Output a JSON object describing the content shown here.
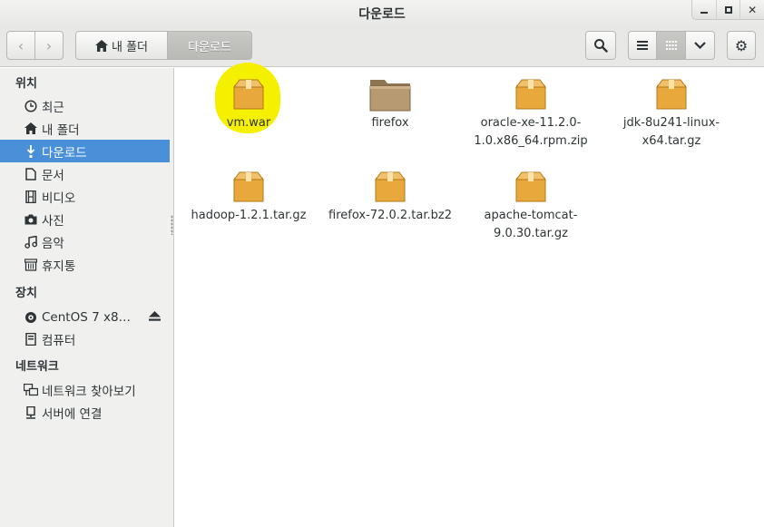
{
  "window": {
    "title": "다운로드",
    "controls": [
      "minimize",
      "maximize",
      "close"
    ]
  },
  "toolbar": {
    "path": [
      {
        "label": "내 폴더",
        "icon": "home-icon"
      },
      {
        "label": "다운로드",
        "active": true
      }
    ],
    "buttons": [
      "back-icon",
      "forward-icon",
      "search-icon",
      "list-view-icon",
      "grid-view-icon",
      "view-menu-icon",
      "gear-icon"
    ]
  },
  "sidebar": {
    "sections": [
      {
        "header": "위치",
        "items": [
          {
            "label": "최근",
            "icon": "clock-icon"
          },
          {
            "label": "내 폴더",
            "icon": "home-icon"
          },
          {
            "label": "다운로드",
            "icon": "download-icon",
            "active": true
          },
          {
            "label": "문서",
            "icon": "document-icon"
          },
          {
            "label": "비디오",
            "icon": "film-icon"
          },
          {
            "label": "사진",
            "icon": "camera-icon"
          },
          {
            "label": "음악",
            "icon": "music-icon"
          },
          {
            "label": "휴지통",
            "icon": "trash-icon"
          }
        ]
      },
      {
        "header": "장치",
        "items": [
          {
            "label": "CentOS 7 x8…",
            "icon": "disc-icon",
            "eject": true
          },
          {
            "label": "컴퓨터",
            "icon": "computer-icon"
          }
        ]
      },
      {
        "header": "네트워크",
        "items": [
          {
            "label": "네트워크 찾아보기",
            "icon": "network-icon"
          },
          {
            "label": "서버에 연결",
            "icon": "server-icon"
          }
        ]
      }
    ]
  },
  "files": [
    {
      "name": "vm.war",
      "type": "package",
      "highlighted": true
    },
    {
      "name": "firefox",
      "type": "folder"
    },
    {
      "name": "oracle-xe-11.2.0-1.0.x86_64.rpm.zip",
      "type": "package"
    },
    {
      "name": "jdk-8u241-linux-x64.tar.gz",
      "type": "package"
    },
    {
      "name": "hadoop-1.2.1.tar.gz",
      "type": "package"
    },
    {
      "name": "firefox-72.0.2.tar.bz2",
      "type": "package"
    },
    {
      "name": "apache-tomcat-9.0.30.tar.gz",
      "type": "package"
    }
  ],
  "colors": {
    "selection": "#4a90d9",
    "highlight": "#f5f000",
    "package": "#e8a83c",
    "folder": "#b89a72"
  }
}
